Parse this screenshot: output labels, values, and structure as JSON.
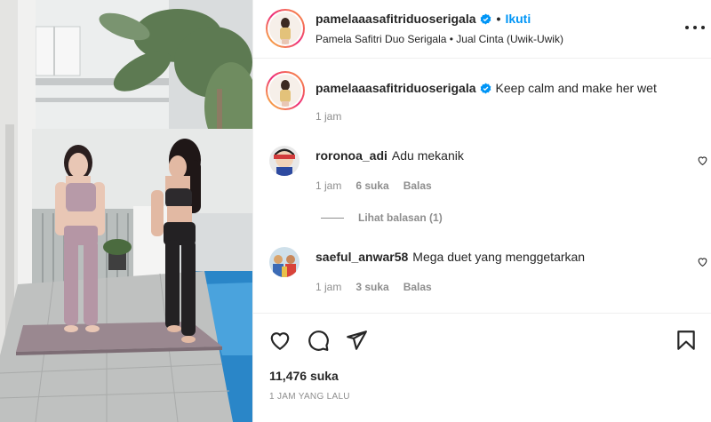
{
  "header": {
    "username": "pamelaaasafitriduoserigala",
    "follow_label": "Ikuti",
    "subtitle": "Pamela Safitri Duo Serigala • Jual Cinta (Uwik-Uwik)"
  },
  "caption": {
    "username": "pamelaaasafitriduoserigala",
    "text": "Keep calm and make her wet",
    "time": "1 jam"
  },
  "comments": [
    {
      "username": "roronoa_adi",
      "text": "Adu mekanik",
      "time": "1 jam",
      "likes": "6 suka",
      "reply_label": "Balas"
    },
    {
      "username": "saeful_anwar58",
      "text": "Mega duet yang menggetarkan",
      "time": "1 jam",
      "likes": "3 suka",
      "reply_label": "Balas"
    }
  ],
  "view_replies": "Lihat balasan (1)",
  "likes_count": "11,476 suka",
  "posted_ago": "1 JAM YANG LALU",
  "colors": {
    "accent": "#0095f6",
    "text": "#262626",
    "muted": "#8e8e8e",
    "divider": "#efefef"
  },
  "icons": [
    "verified-icon",
    "more-options-icon",
    "heart-icon",
    "comment-icon",
    "share-icon",
    "bookmark-icon"
  ]
}
